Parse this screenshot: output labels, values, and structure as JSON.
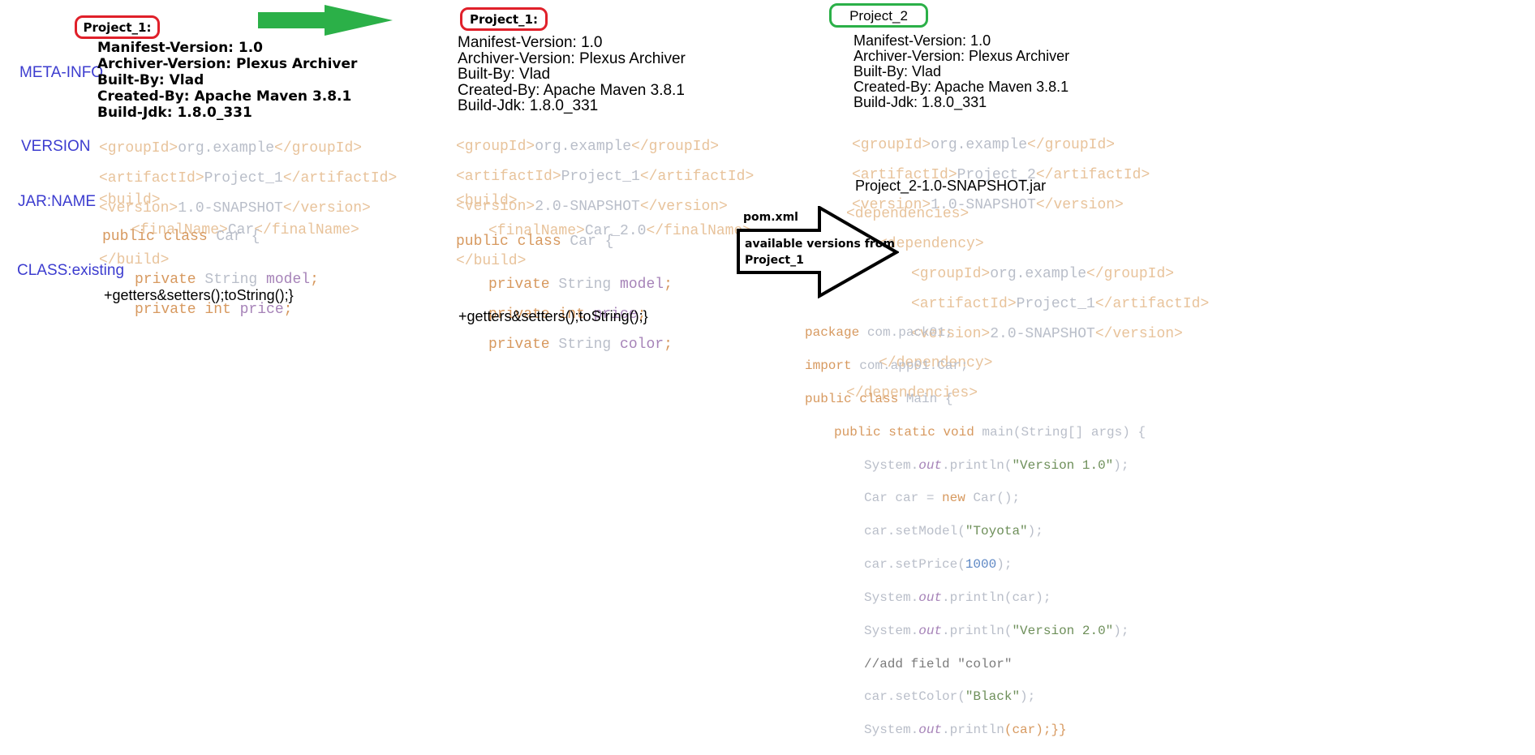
{
  "colors": {
    "red_box": "#e0202a",
    "green_box": "#2bb048",
    "arrow_green": "#2bb048",
    "label_blue": "#3c3ccf"
  },
  "left": {
    "title": "Project_1:",
    "labels": {
      "meta": "META-INFO",
      "version": "VERSION",
      "jar": "JAR:NAME",
      "class": "CLASS:existing"
    },
    "manifest": [
      "Manifest-Version: 1.0",
      "Archiver-Version: Plexus Archiver",
      "Built-By: Vlad",
      "Created-By: Apache Maven 3.8.1",
      "Build-Jdk: 1.8.0_331"
    ],
    "group_open": "<groupId>",
    "group_val": "org.example",
    "group_close": "</groupId>",
    "artifact_open": "<artifactId>",
    "artifact_val": "Project_1",
    "artifact_close": "</artifactId>",
    "version_open": "<version>",
    "version_val": "1.0-SNAPSHOT",
    "version_close": "</version>",
    "build_open": "<build>",
    "final_open": "<finalName>",
    "final_val": "Car",
    "final_close": "</finalName>",
    "build_close": "</build>",
    "class_kw": "public class",
    "class_name": " Car {",
    "f1_kw": "private",
    "f1_type": " String ",
    "f1_name": "model",
    "f1_end": ";",
    "f2_kw": "private int",
    "f2_name": " price",
    "f2_end": ";",
    "getters": "+getters&setters();toString();}"
  },
  "middle": {
    "title": "Project_1:",
    "manifest": [
      "Manifest-Version: 1.0",
      "Archiver-Version: Plexus Archiver",
      "Built-By: Vlad",
      "Created-By: Apache Maven 3.8.1",
      "Build-Jdk: 1.8.0_331"
    ],
    "group_val": "org.example",
    "artifact_val": "Project_1",
    "version_val": "2.0-SNAPSHOT",
    "final_val": "Car_2.0",
    "class_kw": "public class",
    "class_name": " Car {",
    "f1_kw": "private",
    "f1_type": " String ",
    "f1_name": "model",
    "f1_end": ";",
    "f2_kw": "private int",
    "f2_name": " price",
    "f2_end": ";",
    "f3_kw": "private",
    "f3_type": " String ",
    "f3_name": "color",
    "f3_end": ";",
    "getters": "+getters&setters();toString();}"
  },
  "right": {
    "title": "Project_2",
    "manifest": [
      "Manifest-Version: 1.0",
      "Archiver-Version: Plexus Archiver",
      "Built-By: Vlad",
      "Created-By: Apache Maven 3.8.1",
      "Build-Jdk: 1.8.0_331"
    ],
    "group_val": "org.example",
    "artifact_val": "Project_2",
    "version_val": "1.0-SNAPSHOT",
    "jar_name": "Project_2-1.0-SNAPSHOT.jar",
    "deps_open": "<dependencies>",
    "dep_open": "<dependency>",
    "dep_group": "org.example",
    "dep_artifact": "Project_1",
    "dep_version": "2.0-SNAPSHOT",
    "dep_close": "</dependency>",
    "deps_close": "</dependencies>",
    "arrow_label1": "pom.xml",
    "arrow_label2": "available versions from",
    "arrow_label3": "Project_1",
    "pkg_kw": "package",
    "pkg_val": " com.pack01;",
    "imp_kw": "import",
    "imp_val": " com.app01.Car;",
    "main_kw": "public class",
    "main_name": " Main {",
    "psvm_kw": "public static void",
    "psvm_rest": " main(String[] args) {",
    "sys": "System.",
    "out": "out",
    "println": ".println(",
    "str_v1": "\"Version 1.0\"",
    "close_paren": ");",
    "car_decl": "Car car = ",
    "new_kw": "new",
    "car_ctor": " Car();",
    "setmodel": "car.setModel(",
    "str_toyota": "\"Toyota\"",
    "setprice": "car.setPrice(",
    "num_1000": "1000",
    "println_car": "(car);",
    "str_v2": "\"Version 2.0\"",
    "comment": "//add field \"color\"",
    "setcolor": "car.setColor(",
    "str_black": "\"Black\"",
    "last_end": "(car);}}"
  }
}
